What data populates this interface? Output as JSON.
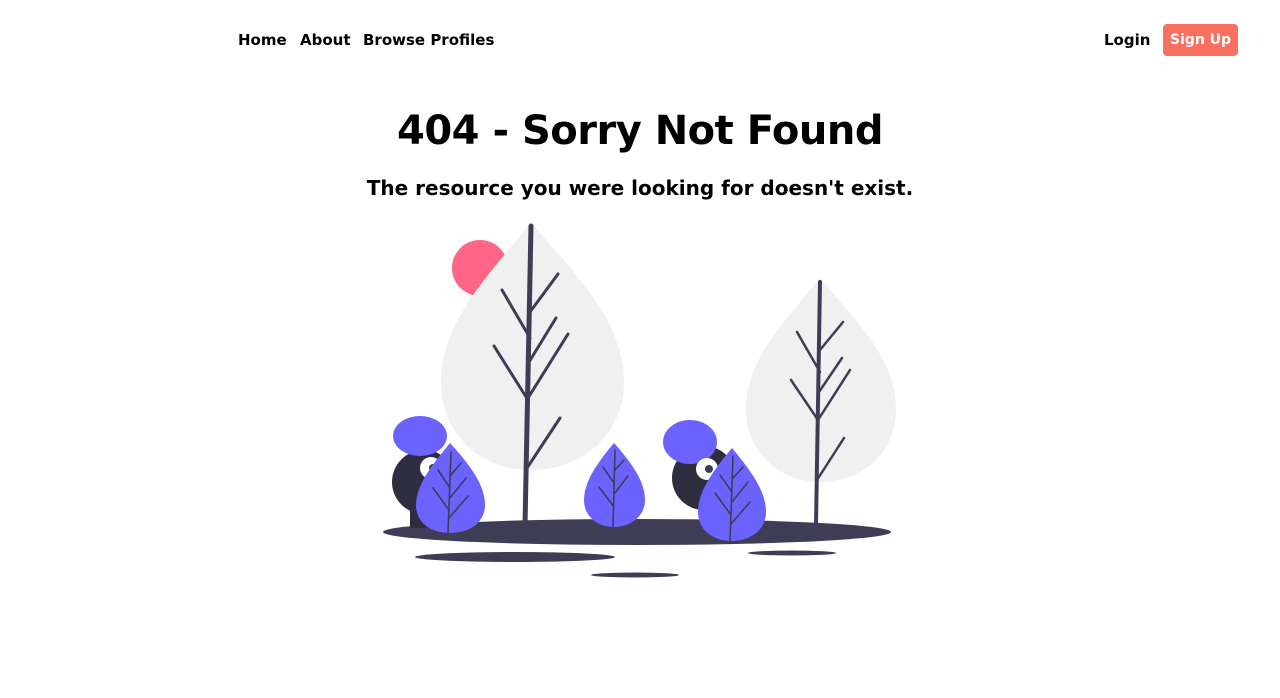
{
  "nav": {
    "home_label": "Home",
    "about_label": "About",
    "browse_label": "Browse Profiles",
    "login_label": "Login",
    "signup_label": "Sign Up"
  },
  "main": {
    "title": "404 - Sorry Not Found",
    "subtitle": "The resource you were looking for doesn't exist."
  },
  "illustration": {
    "icon": "trees-hiding-figures-illustration"
  },
  "colors": {
    "accent": "#f87060",
    "sun": "#ff6584",
    "leaf": "#6c63ff",
    "ink": "#3f3d56",
    "tree_canopy": "#f0f0f0",
    "figure_body": "#2f2e41"
  }
}
